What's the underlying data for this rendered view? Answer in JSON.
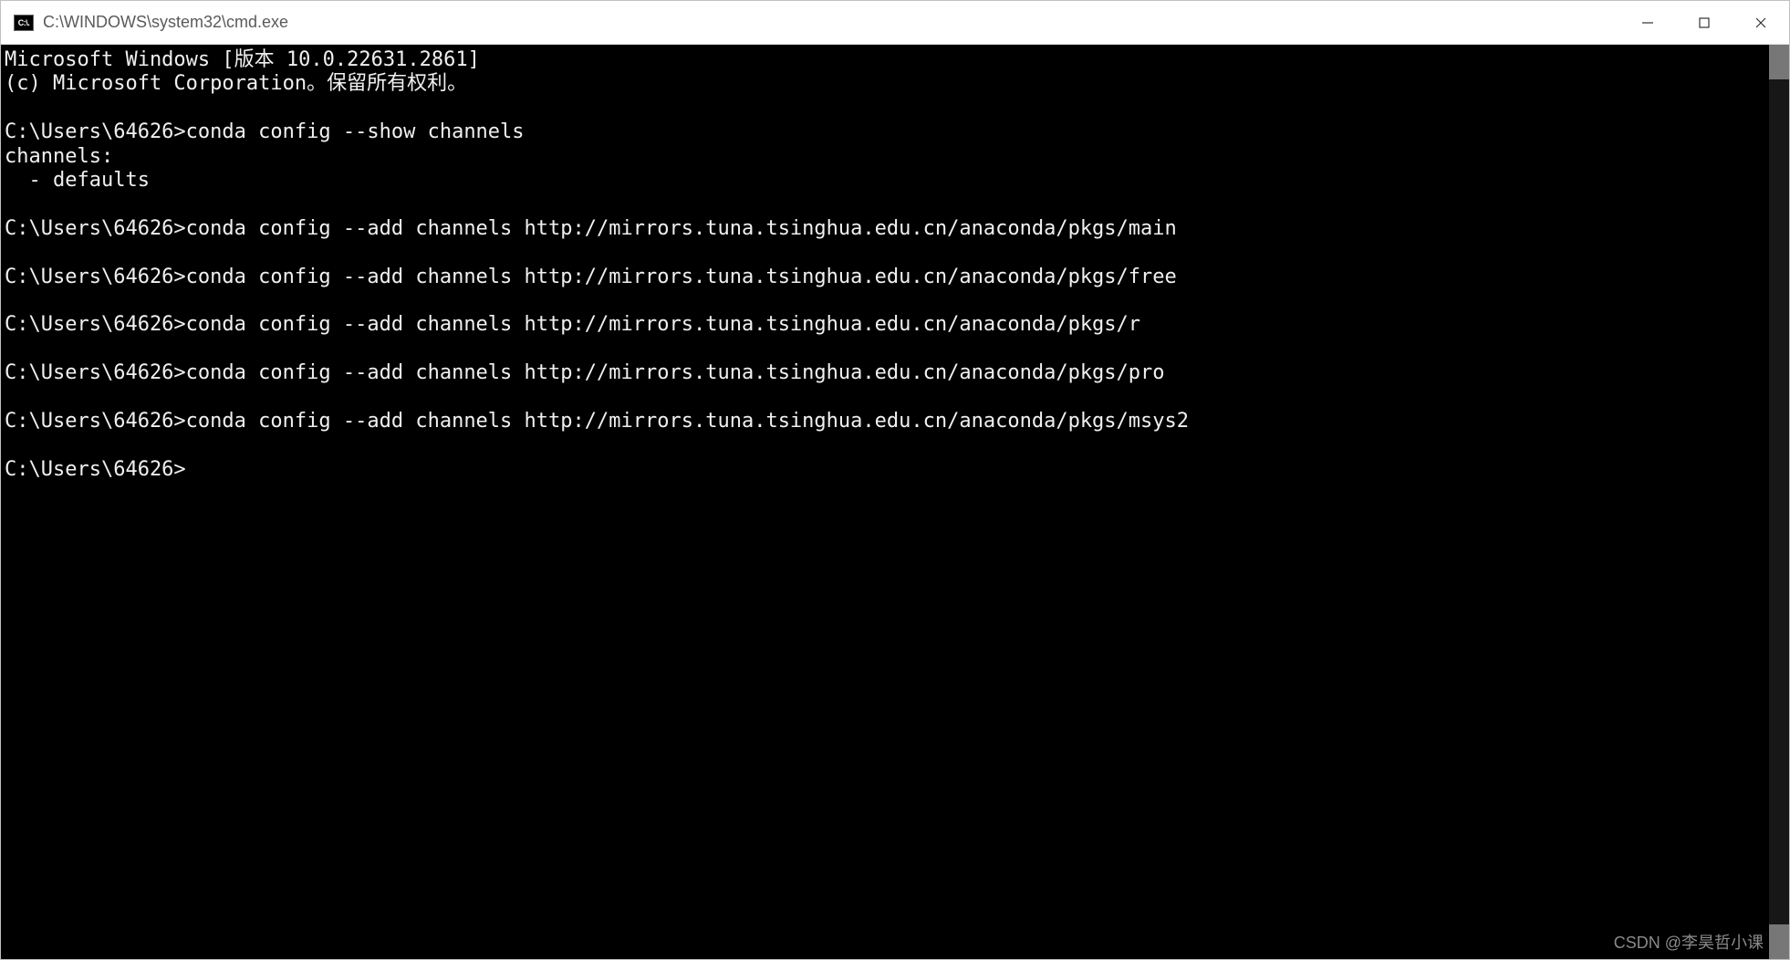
{
  "window": {
    "icon_label": "C:\\.",
    "title": "C:\\WINDOWS\\system32\\cmd.exe"
  },
  "terminal": {
    "lines": {
      "l0": "Microsoft Windows [版本 10.0.22631.2861]",
      "l1": "(c) Microsoft Corporation。保留所有权利。",
      "l2": "C:\\Users\\64626>conda config --show channels",
      "l3": "channels:",
      "l4": "  - defaults",
      "l5": "C:\\Users\\64626>conda config --add channels http://mirrors.tuna.tsinghua.edu.cn/anaconda/pkgs/main",
      "l6": "C:\\Users\\64626>conda config --add channels http://mirrors.tuna.tsinghua.edu.cn/anaconda/pkgs/free",
      "l7": "C:\\Users\\64626>conda config --add channels http://mirrors.tuna.tsinghua.edu.cn/anaconda/pkgs/r",
      "l8": "C:\\Users\\64626>conda config --add channels http://mirrors.tuna.tsinghua.edu.cn/anaconda/pkgs/pro",
      "l9": "C:\\Users\\64626>conda config --add channels http://mirrors.tuna.tsinghua.edu.cn/anaconda/pkgs/msys2",
      "l10": "C:\\Users\\64626>"
    }
  },
  "watermark": "CSDN @李昊哲小课"
}
